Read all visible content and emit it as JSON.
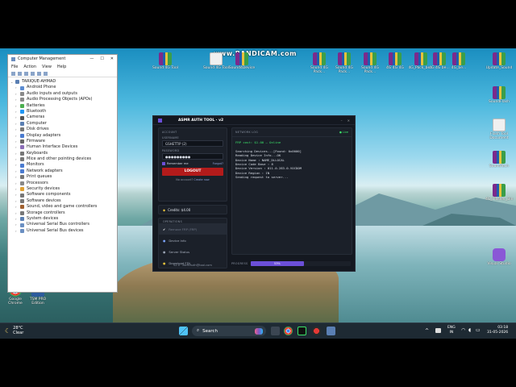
{
  "desktop": {
    "watermark": "www.BANDICAM.com",
    "icons_top": [
      {
        "label": "Sound 4G Tool",
        "type": "rar"
      },
      {
        "label": "Sound 4G Tool",
        "type": "doc"
      },
      {
        "label": "Sound4Device",
        "type": "rar"
      },
      {
        "label": "",
        "type": "folder"
      },
      {
        "label": "Sound 4G Pack...",
        "type": "rar"
      },
      {
        "label": "Sound 4G Pack...",
        "type": "rar"
      },
      {
        "label": "Sound 4G Pack...",
        "type": "rar"
      },
      {
        "label": "4G 4G 4G",
        "type": "rar"
      },
      {
        "label": "4G_Pack_be...",
        "type": "rar"
      },
      {
        "label": "4G 4G be...",
        "type": "rar"
      },
      {
        "label": "4G_be...",
        "type": "rar"
      }
    ],
    "icons_right": [
      {
        "label": "Update_Sound",
        "type": "rar"
      },
      {
        "label": "SoundFlash",
        "type": "rar"
      },
      {
        "label": "Flash Tool Document",
        "type": "doc"
      },
      {
        "label": "SoundTech",
        "type": "rar"
      },
      {
        "label": "4G_Flasher_Bin",
        "type": "rar"
      },
      {
        "label": "Visual Studio",
        "type": "rar"
      }
    ],
    "icons_left": [
      {
        "label": "Google Chrome",
        "type": "doc"
      },
      {
        "label": "TSM PRO Edition",
        "type": "doc"
      }
    ]
  },
  "cm": {
    "title": "Computer Management",
    "menu": [
      "File",
      "Action",
      "View",
      "Help"
    ],
    "root": "TARIQUE-AHMAD",
    "items": [
      "Android Phone",
      "Audio inputs and outputs",
      "Audio Processing Objects (APOs)",
      "Batteries",
      "Bluetooth",
      "Cameras",
      "Computer",
      "Disk drives",
      "Display adapters",
      "Firmware",
      "Human Interface Devices",
      "Keyboards",
      "Mice and other pointing devices",
      "Monitors",
      "Network adapters",
      "Print queues",
      "Processors",
      "Security devices",
      "Software components",
      "Software devices",
      "Sound, video and game controllers",
      "Storage controllers",
      "System devices",
      "Universal Serial Bus controllers",
      "Universal Serial Bus devices"
    ]
  },
  "tool": {
    "title": "ASMR AUTH TOOL · v2",
    "account_label": "ACCOUNT",
    "username_label": "USERNAME",
    "username": "GSHETTIP (2)",
    "password_label": "PASSWORD",
    "password": "●●●●●●●●●",
    "remember": "Remember me",
    "forgot": "Forgot?",
    "logout": "LOGOUT",
    "signup_text": "No account?",
    "signup_link": "Create now",
    "credits": "Credits: $4.00",
    "operations_label": "OPERATIONS",
    "operations": [
      "Remove FRP (FRP)",
      "Device Info",
      "Server Status",
      "Download FDL"
    ],
    "network_label": "NETWORK LOG",
    "live": "● Live",
    "log": [
      {
        "text": "FRP cost: $1.00 — Online",
        "color": "g"
      },
      {
        "text": "",
        "color": ""
      },
      {
        "text": "Searching Devices...[Found: 0x0000]",
        "color": ""
      },
      {
        "text": "Reading Device Info...OK",
        "color": ""
      },
      {
        "text": "Device Name : NAME_DLLOCAL",
        "color": ""
      },
      {
        "text": "Device Code Base : 8",
        "color": ""
      },
      {
        "text": "Device Version : 011.0.283.0.VOCDOM",
        "color": ""
      },
      {
        "text": "Device Region : IN",
        "color": ""
      },
      {
        "text": "Sending request to server...",
        "color": ""
      }
    ],
    "progress_label": "PROGRESS",
    "progress_value": 0.53,
    "progress_text": "53%",
    "footer": "v2.0 · asmrauth@tool.com"
  },
  "taskbar": {
    "weather_temp": "28°C",
    "weather_desc": "Clear",
    "search": "Search",
    "lang": "ENG",
    "lang2": "IN",
    "time": "03:18",
    "date": "31-05-2026"
  }
}
